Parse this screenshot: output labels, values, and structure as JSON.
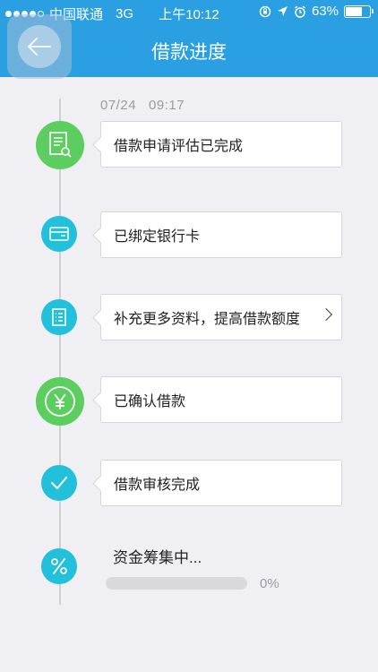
{
  "status_bar": {
    "carrier": "中国联通",
    "network": "3G",
    "time": "上午10:12",
    "battery_text": "63%",
    "battery_level": 0.63
  },
  "header": {
    "title": "借款进度",
    "back_icon": "back-arrow-icon",
    "color": "#2aa0e3"
  },
  "timeline": {
    "timestamp": "07/24   09:17",
    "steps": [
      {
        "label": "借款申请评估已完成",
        "icon": "document-search-icon",
        "color": "#5ccd5f"
      },
      {
        "label": "已绑定银行卡",
        "icon": "bank-card-icon",
        "color": "#22c0db"
      },
      {
        "label": "补充更多资料，提高借款额度",
        "icon": "list-document-icon",
        "color": "#22c0db",
        "has_chevron": true
      },
      {
        "label": "已确认借款",
        "icon": "yen-icon",
        "color": "#5ccd5f"
      },
      {
        "label": "借款审核完成",
        "icon": "check-icon",
        "color": "#22c0db"
      },
      {
        "label": "资金筹集中...",
        "icon": "percent-icon",
        "color": "#22c0db"
      }
    ]
  },
  "fundraising": {
    "progress_text": "0%",
    "progress_value": 0
  }
}
